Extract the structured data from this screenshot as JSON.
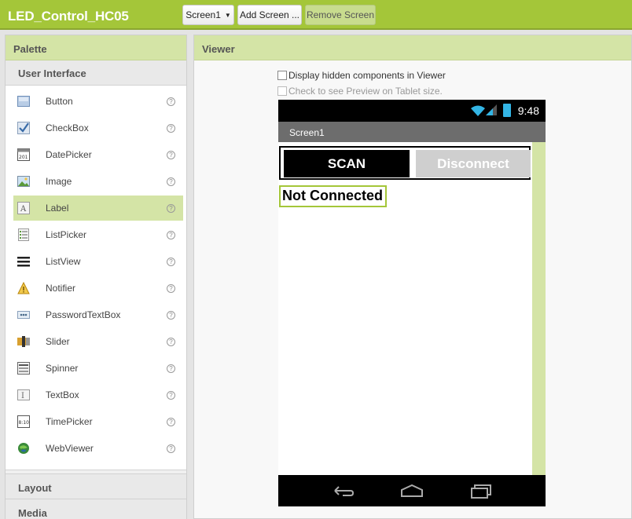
{
  "app": {
    "project_title": "LED_Control_HC05",
    "screen_dropdown": "Screen1",
    "add_screen": "Add Screen ...",
    "remove_screen": "Remove Screen"
  },
  "palette": {
    "title": "Palette",
    "category": "User Interface",
    "help_glyph": "?",
    "items": [
      {
        "label": "Button",
        "icon": "button-icon"
      },
      {
        "label": "CheckBox",
        "icon": "checkbox-icon"
      },
      {
        "label": "DatePicker",
        "icon": "datepicker-icon"
      },
      {
        "label": "Image",
        "icon": "image-icon"
      },
      {
        "label": "Label",
        "icon": "label-icon",
        "selected": true
      },
      {
        "label": "ListPicker",
        "icon": "listpicker-icon"
      },
      {
        "label": "ListView",
        "icon": "listview-icon"
      },
      {
        "label": "Notifier",
        "icon": "notifier-icon"
      },
      {
        "label": "PasswordTextBox",
        "icon": "password-icon"
      },
      {
        "label": "Slider",
        "icon": "slider-icon"
      },
      {
        "label": "Spinner",
        "icon": "spinner-icon"
      },
      {
        "label": "TextBox",
        "icon": "textbox-icon"
      },
      {
        "label": "TimePicker",
        "icon": "timepicker-icon"
      },
      {
        "label": "WebViewer",
        "icon": "webviewer-icon"
      }
    ],
    "sections": [
      "Layout",
      "Media"
    ]
  },
  "viewer": {
    "title": "Viewer",
    "show_hidden_label": "Display hidden components in Viewer",
    "tablet_preview_label": "Check to see Preview on Tablet size."
  },
  "phone": {
    "time": "9:48",
    "screen_title": "Screen1",
    "scan_button": "SCAN",
    "disconnect_button": "Disconnect",
    "status_label": "Not Connected"
  },
  "colors": {
    "accent": "#a4c639",
    "selection": "#d4e4a6",
    "battery": "#33b5e5"
  }
}
